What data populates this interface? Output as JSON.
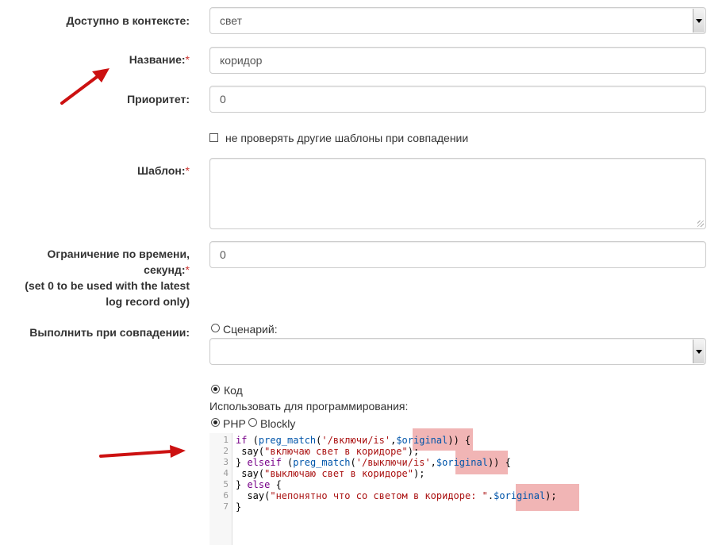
{
  "form": {
    "context": {
      "label": "Доступно в контексте:",
      "value": "свет"
    },
    "name": {
      "label": "Название:",
      "value": "коридор"
    },
    "priority": {
      "label": "Приоритет:",
      "value": "0"
    },
    "skip_check": {
      "label": "не проверять другие шаблоны при совпадении"
    },
    "pattern": {
      "label": "Шаблон:",
      "value": ""
    },
    "time_limit": {
      "label_line1": "Ограничение по времени,",
      "label_line2": "секунд:",
      "note_line1": "(set 0 to be used with the latest",
      "note_line2": "log record only)",
      "value": "0"
    },
    "execute": {
      "label": "Выполнить при совпадении:",
      "option_script": "Сценарий:",
      "script_value": "",
      "option_code": "Код",
      "use_for_programming": "Использовать для программирования:",
      "lang_php": "PHP",
      "lang_blockly": "Blockly"
    }
  },
  "required_mark": "*",
  "code": {
    "line_numbers": [
      "1",
      "2",
      "3",
      "4",
      "5",
      "6",
      "7"
    ],
    "l1": {
      "a": "if",
      "b": " (",
      "c": "preg_match",
      "d": "(",
      "e": "'/включи/is'",
      "f": ",",
      "g": "$original",
      "h": ")) {"
    },
    "l2": {
      "a": " say(",
      "b": "\"включаю свет в коридоре\"",
      "c": ");"
    },
    "l3": {
      "a": "} ",
      "b": "elseif",
      "c": " (",
      "d": "preg_match",
      "e": "(",
      "f": "'/выключи/is'",
      "g": ",",
      "h": "$original",
      "i": ")) {"
    },
    "l4": {
      "a": " say(",
      "b": "\"выключаю свет в коридоре\"",
      "c": ");"
    },
    "l5": {
      "a": "} ",
      "b": "else",
      "c": " {"
    },
    "l6": {
      "a": "  say(",
      "b": "\"непонятно что со светом в коридоре: \"",
      "c": ".",
      "d": "$original",
      "e": ");"
    },
    "l7": {
      "a": "}"
    }
  },
  "colors": {
    "arrow": "#cc1111",
    "highlight": "#e87878"
  }
}
